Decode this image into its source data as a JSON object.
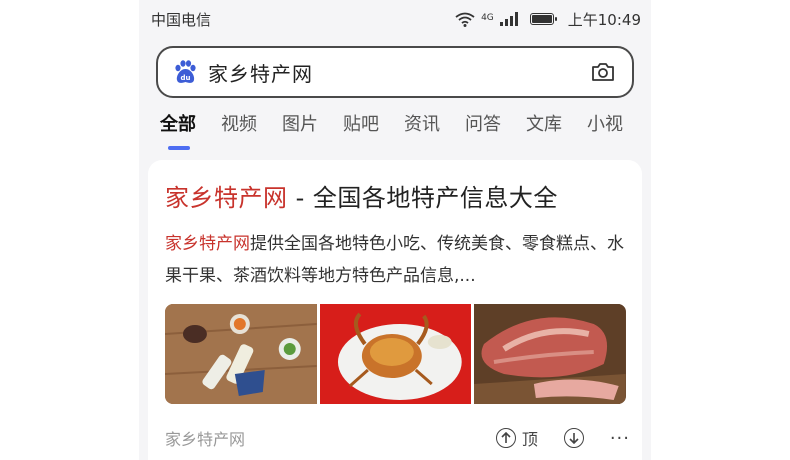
{
  "status_bar": {
    "carrier": "中国电信",
    "network": "4G",
    "time": "上午10:49"
  },
  "search": {
    "query": "家乡特产网"
  },
  "tabs": [
    {
      "label": "全部",
      "active": true
    },
    {
      "label": "视频",
      "active": false
    },
    {
      "label": "图片",
      "active": false
    },
    {
      "label": "贴吧",
      "active": false
    },
    {
      "label": "资讯",
      "active": false
    },
    {
      "label": "问答",
      "active": false
    },
    {
      "label": "文库",
      "active": false
    },
    {
      "label": "小视",
      "active": false
    }
  ],
  "result": {
    "title_keyword": "家乡特产网",
    "title_rest": " - 全国各地特产信息大全",
    "desc_keyword": "家乡特产网",
    "desc_rest": "提供全国各地特色小吃、传统美食、零食糕点、水果干果、茶酒饮料等地方特色产品信息,...",
    "source": "家乡特产网",
    "upvote_label": "顶"
  },
  "colors": {
    "accent": "#4e6ef2",
    "keyword": "#c8332c"
  }
}
